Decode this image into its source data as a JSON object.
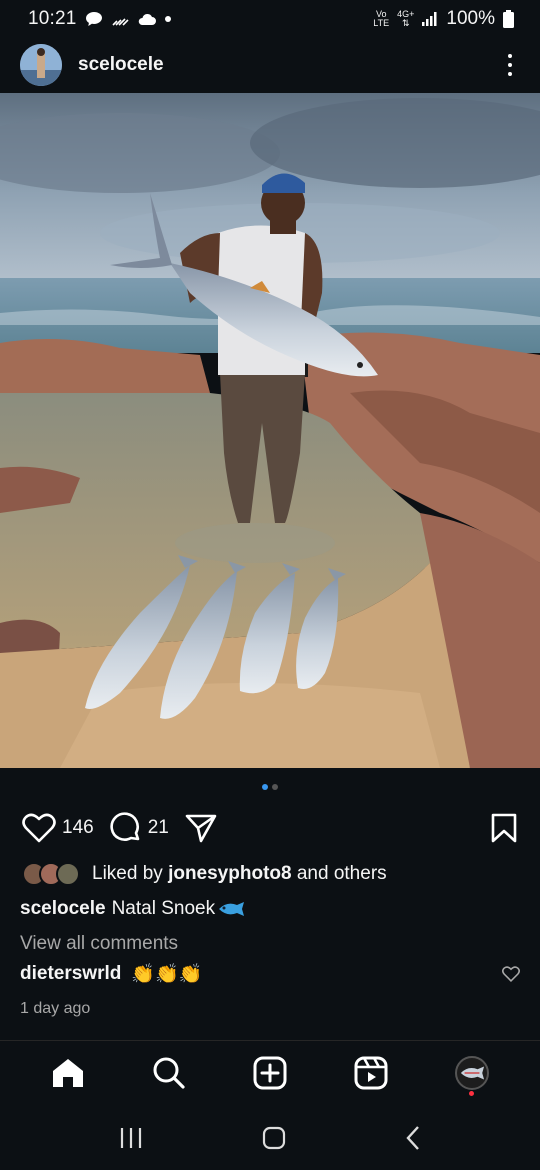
{
  "status_bar": {
    "time": "10:21",
    "left_icons": [
      "message-bubble-icon",
      "wifi-calling-icon",
      "cloud-icon",
      "notification-dot"
    ],
    "volte_top": "Vo",
    "volte_bottom": "LTE",
    "network_type": "4G+",
    "battery_percent": "100%"
  },
  "post": {
    "username": "scelocele",
    "image_pages": 2,
    "active_page": 1
  },
  "actions": {
    "like_count": "146",
    "comment_count": "21"
  },
  "likes": {
    "prefix": "Liked by",
    "user": "jonesyphoto8",
    "suffix": "and others"
  },
  "caption": {
    "username": "scelocele",
    "text": "Natal Snoek",
    "emoji_icon": "fish-icon"
  },
  "comments": {
    "view_all": "View all comments",
    "first_user": "dieterswrld",
    "first_text": "👏👏👏"
  },
  "time_ago": "1 day ago",
  "bottom_nav": [
    "home-icon",
    "search-icon",
    "create-icon",
    "reels-icon",
    "profile-avatar"
  ],
  "colors": {
    "background": "#0c1014",
    "accent": "#3897f0",
    "muted_text": "#a8a8a8",
    "notification": "#ff3040"
  }
}
